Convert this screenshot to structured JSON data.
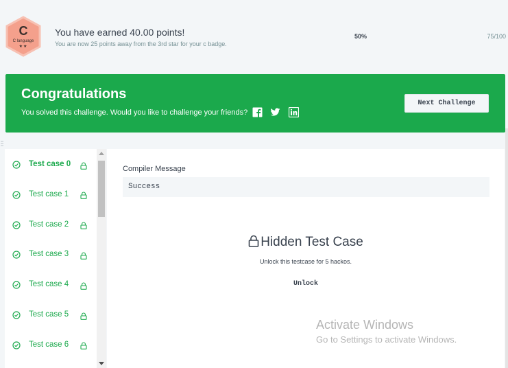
{
  "badge": {
    "letter": "C",
    "name": "C language",
    "stars": "★★",
    "color": "#f4a08c",
    "icon": "hexagon-badge-icon"
  },
  "earned": {
    "title": "You have earned 40.00 points!",
    "subtitle": "You are now 25 points away from the 3rd star for your c badge."
  },
  "progress": {
    "percent_label": "50%",
    "count_label": "75/100",
    "fraction": 0.5
  },
  "congrats": {
    "title": "Congratulations",
    "subtitle": "You solved this challenge. Would you like to challenge your friends?",
    "next_button": "Next Challenge",
    "color": "#1ba94c",
    "social_icons": [
      "facebook-icon",
      "twitter-icon",
      "linkedin-icon"
    ]
  },
  "test_cases": [
    {
      "label": "Test case 0",
      "active": true
    },
    {
      "label": "Test case 1",
      "active": false
    },
    {
      "label": "Test case 2",
      "active": false
    },
    {
      "label": "Test case 3",
      "active": false
    },
    {
      "label": "Test case 4",
      "active": false
    },
    {
      "label": "Test case 5",
      "active": false
    },
    {
      "label": "Test case 6",
      "active": false
    }
  ],
  "compiler": {
    "label": "Compiler Message",
    "message": "Success"
  },
  "hidden": {
    "title": "Hidden Test Case",
    "subtitle": "Unlock this testcase for 5 hackos.",
    "unlock_button": "Unlock"
  },
  "watermark": {
    "title": "Activate Windows",
    "subtitle": "Go to Settings to activate Windows."
  }
}
